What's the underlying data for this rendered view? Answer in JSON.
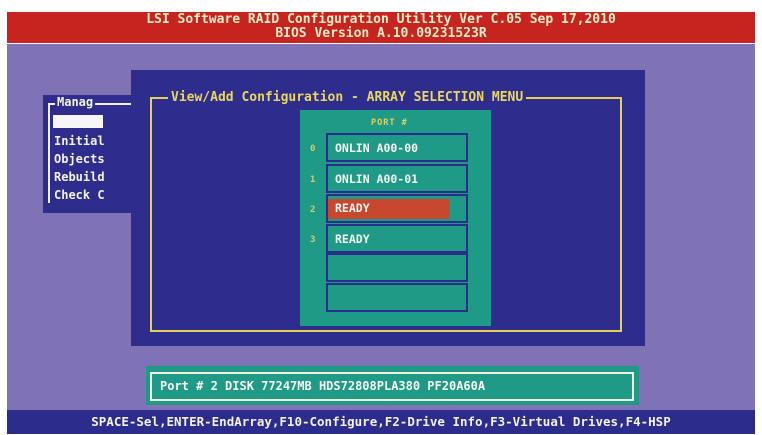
{
  "header": {
    "line1": "LSI Software RAID Configuration Utility Ver C.05 Sep 17,2010",
    "line2": "BIOS Version  A.10.09231523R"
  },
  "main_menu": {
    "title": "Manag",
    "items": [
      "Initial",
      "Objects",
      "Rebuild",
      "Check C"
    ]
  },
  "dialog": {
    "title": "View/Add Configuration - ARRAY SELECTION MENU",
    "port_header": "PORT #",
    "ports": [
      {
        "index": "0",
        "label": "ONLIN A00-00",
        "selected": false
      },
      {
        "index": "1",
        "label": "ONLIN A00-01",
        "selected": false
      },
      {
        "index": "2",
        "label": "READY",
        "selected": true
      },
      {
        "index": "3",
        "label": "READY",
        "selected": false
      },
      {
        "index": "",
        "label": "",
        "selected": false
      },
      {
        "index": "",
        "label": "",
        "selected": false
      }
    ]
  },
  "status_line": "Port # 2 DISK  77247MB  HDS72808PLA380  PF20A60A",
  "footer": "SPACE-Sel,ENTER-EndArray,F10-Configure,F2-Drive Info,F3-Virtual Drives,F4-HSP",
  "colors": {
    "header_bg": "#c7231f",
    "screen_bg": "#7f73b6",
    "dialog_bg": "#2e2d8e",
    "panel_bg": "#1e9a86",
    "selection_bg": "#c8472f",
    "title_text": "#e7d85c"
  }
}
